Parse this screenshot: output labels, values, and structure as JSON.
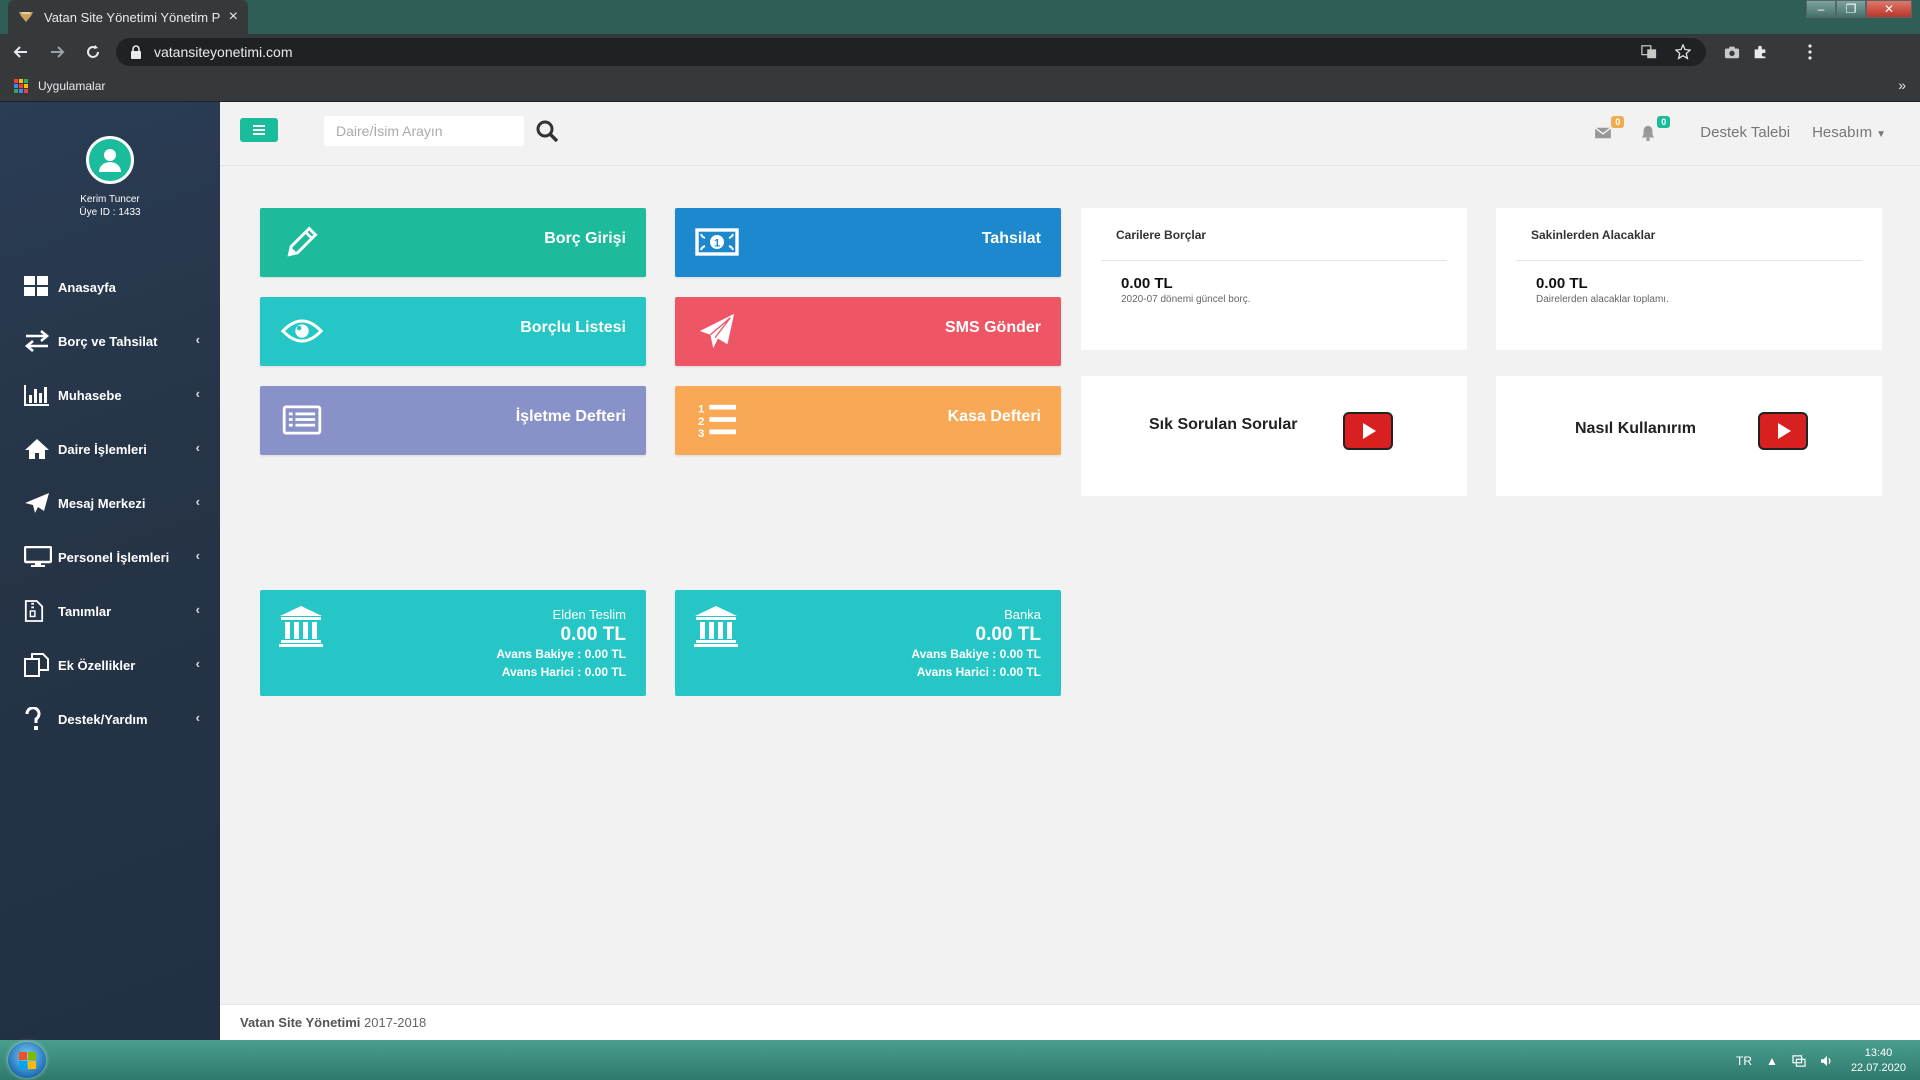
{
  "browser": {
    "tab_title": "Vatan Site Yönetimi Yönetim Pro",
    "tab_close": "×",
    "url": "vatansiteyonetimi.com",
    "bookmarks_label": "Uygulamalar",
    "more_label": "»"
  },
  "sidebar": {
    "user_name": "Kerim Tuncer",
    "user_id": "Üye ID : 1433",
    "items": [
      {
        "label": "Anasayfa",
        "icon": "dashboard-icon"
      },
      {
        "label": "Borç ve Tahsilat",
        "icon": "exchange-icon"
      },
      {
        "label": "Muhasebe",
        "icon": "bar-chart-icon"
      },
      {
        "label": "Daire İşlemleri",
        "icon": "home-icon"
      },
      {
        "label": "Mesaj Merkezi",
        "icon": "paper-plane-icon"
      },
      {
        "label": "Personel İşlemleri",
        "icon": "monitor-icon"
      },
      {
        "label": "Tanımlar",
        "icon": "file-zip-icon"
      },
      {
        "label": "Ek Özellikler",
        "icon": "copy-icon"
      },
      {
        "label": "Destek/Yardım",
        "icon": "question-icon"
      }
    ]
  },
  "header": {
    "search_placeholder": "Daire/İsim Arayın",
    "mail_count": "0",
    "notif_count": "0",
    "support_label": "Destek Talebi",
    "account_label": "Hesabım"
  },
  "tiles": {
    "borc_girisi": "Borç Girişi",
    "tahsilat": "Tahsilat",
    "borclu_listesi": "Borçlu Listesi",
    "sms_gonder": "SMS Gönder",
    "isletme_defteri": "İşletme Defteri",
    "kasa_defteri": "Kasa Defteri"
  },
  "cards": {
    "cariler_title": "Carilere Borçlar",
    "cariler_value": "0.00 TL",
    "cariler_sub": "2020-07 dönemi güncel borç.",
    "sakinler_title": "Sakinlerden Alacaklar",
    "sakinler_value": "0.00 TL",
    "sakinler_sub": "Dairelerden alacaklar toplamı."
  },
  "videos": {
    "faq": "Sık Sorulan Sorular",
    "howto": "Nasıl Kullanırım"
  },
  "banks": [
    {
      "name": "Elden Teslim",
      "value": "0.00 TL",
      "avans_bakiye": "Avans Bakiye : 0.00 TL",
      "avans_harici": "Avans Harici : 0.00 TL"
    },
    {
      "name": "Banka",
      "value": "0.00 TL",
      "avans_bakiye": "Avans Bakiye : 0.00 TL",
      "avans_harici": "Avans Harici : 0.00 TL"
    }
  ],
  "footer": {
    "brand": "Vatan Site Yönetimi",
    "years": " 2017-2018"
  },
  "taskbar": {
    "lang": "TR",
    "time": "13:40",
    "date": "22.07.2020"
  },
  "colors": {
    "green": "#1abc9c",
    "blue": "#1e88cf",
    "teal": "#26c6c6",
    "red": "#ee5565",
    "purple": "#8891c8",
    "orange": "#f9a855",
    "sidebar": "#263447"
  }
}
